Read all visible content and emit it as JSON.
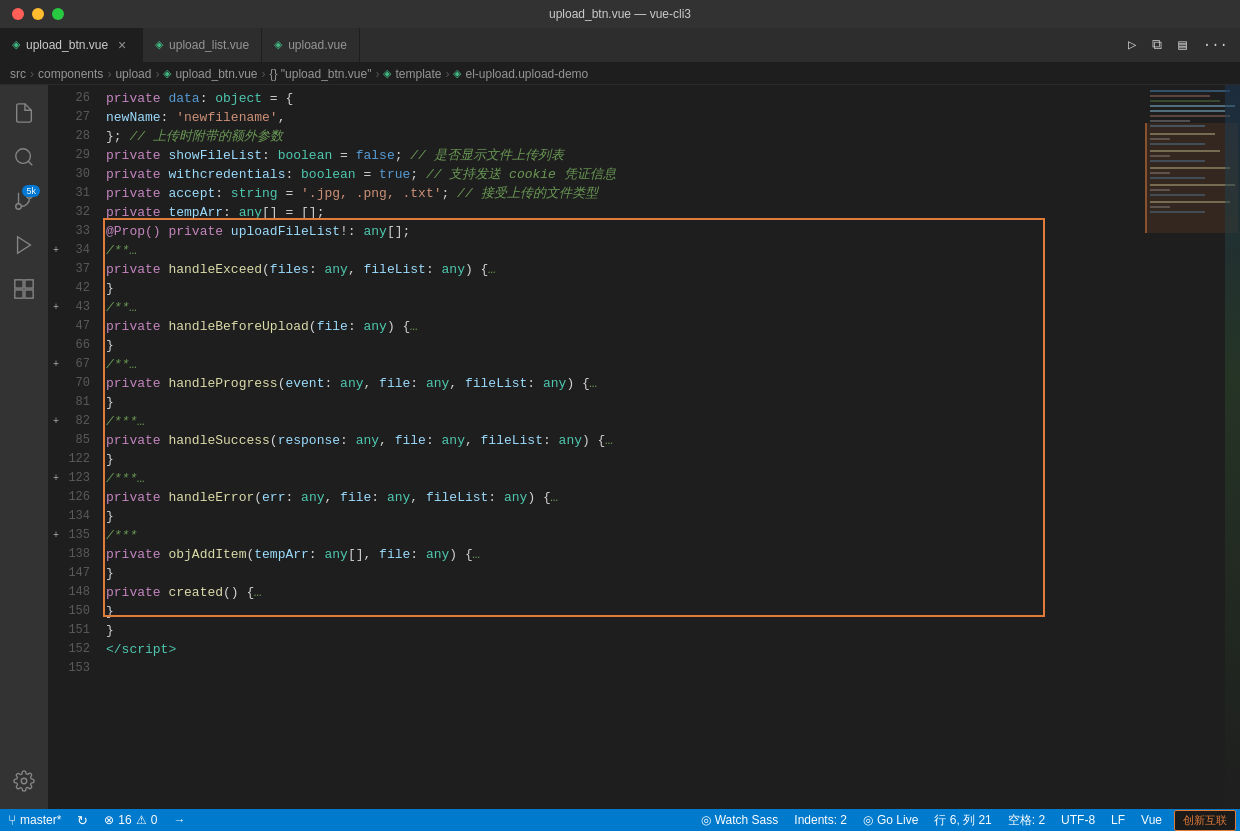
{
  "titleBar": {
    "title": "upload_btn.vue — vue-cli3"
  },
  "tabs": [
    {
      "id": "upload_btn",
      "label": "upload_btn.vue",
      "active": true,
      "icon": "V",
      "closable": true
    },
    {
      "id": "upload_list",
      "label": "upload_list.vue",
      "active": false,
      "icon": "V",
      "closable": false
    },
    {
      "id": "upload",
      "label": "upload.vue",
      "active": false,
      "icon": "V",
      "closable": false
    }
  ],
  "breadcrumb": [
    "src",
    "components",
    "upload",
    "upload_btn.vue",
    "{} \"upload_btn.vue\"",
    "template",
    "el-upload.upload-demo"
  ],
  "activityBar": {
    "icons": [
      {
        "id": "explorer",
        "symbol": "⎘",
        "active": false
      },
      {
        "id": "search",
        "symbol": "⌕",
        "active": false
      },
      {
        "id": "source-control",
        "symbol": "⑂",
        "active": false,
        "badge": "5k"
      },
      {
        "id": "debug",
        "symbol": "⬡",
        "active": false
      },
      {
        "id": "extensions",
        "symbol": "⊞",
        "active": false
      }
    ],
    "bottomIcons": [
      {
        "id": "settings",
        "symbol": "⚙",
        "active": false
      }
    ]
  },
  "codeLines": [
    {
      "num": "26",
      "hasExpand": false,
      "content": "    <span class='kw2'>private</span> <span class='kw'>data</span>: <span class='type'>object</span> = {"
    },
    {
      "num": "27",
      "hasExpand": false,
      "content": "      <span class='prop'>newName</span>: <span class='str'>'newfilename'</span>,"
    },
    {
      "num": "28",
      "hasExpand": false,
      "content": "    }; <span class='comment'>// 上传时附带的额外参数</span>"
    },
    {
      "num": "29",
      "hasExpand": false,
      "content": "    <span class='kw2'>private</span> <span class='prop'>showFileList</span>: <span class='type'>boolean</span> = <span class='bool'>false</span>; <span class='comment'>// 是否显示文件上传列表</span>"
    },
    {
      "num": "30",
      "hasExpand": false,
      "content": "    <span class='kw2'>private</span> <span class='prop'>withcredentials</span>: <span class='type'>boolean</span> = <span class='bool'>true</span>; <span class='comment'>// 支持发送 cookie 凭证信息</span>"
    },
    {
      "num": "31",
      "hasExpand": false,
      "content": "    <span class='kw2'>private</span> <span class='prop'>accept</span>: <span class='type'>string</span> = <span class='str'>'.jpg, .png, .txt'</span>; <span class='comment'>// 接受上传的文件类型</span>"
    },
    {
      "num": "32",
      "hasExpand": false,
      "content": "    <span class='kw2'>private</span> <span class='prop'>tempArr</span>: <span class='type'>any</span>[] = [];"
    },
    {
      "num": "33",
      "hasExpand": false,
      "content": "    <span class='decorator'>@Prop()</span> <span class='kw2'>private</span> <span class='prop'>uploadFileList</span>!: <span class='type'>any</span>[];"
    },
    {
      "num": "34",
      "hasExpand": true,
      "content": "    <span class='comment'>/**…</span>",
      "highlighted": true
    },
    {
      "num": "37",
      "hasExpand": false,
      "content": "    <span class='kw2'>private</span> <span class='fn'>handleExceed</span>(<span class='prop'>files</span>: <span class='type'>any</span>, <span class='prop'>fileList</span>: <span class='type'>any</span>) {<span class='comment'>…</span>",
      "highlighted": true
    },
    {
      "num": "42",
      "hasExpand": false,
      "content": "    }",
      "highlighted": true
    },
    {
      "num": "43",
      "hasExpand": true,
      "content": "    <span class='comment'>/**…</span>",
      "highlighted": true
    },
    {
      "num": "47",
      "hasExpand": false,
      "content": "    <span class='kw2'>private</span> <span class='fn'>handleBeforeUpload</span>(<span class='prop'>file</span>: <span class='type'>any</span>) {<span class='comment'>…</span>",
      "highlighted": true
    },
    {
      "num": "66",
      "hasExpand": false,
      "content": "    }",
      "highlighted": true
    },
    {
      "num": "67",
      "hasExpand": true,
      "content": "    <span class='comment'>/**…</span>",
      "highlighted": true
    },
    {
      "num": "70",
      "hasExpand": false,
      "content": "    <span class='kw2'>private</span> <span class='fn'>handleProgress</span>(<span class='prop'>event</span>: <span class='type'>any</span>, <span class='prop'>file</span>: <span class='type'>any</span>, <span class='prop'>fileList</span>: <span class='type'>any</span>) {<span class='comment'>…</span>",
      "highlighted": true
    },
    {
      "num": "81",
      "hasExpand": false,
      "content": "    }",
      "highlighted": true
    },
    {
      "num": "82",
      "hasExpand": true,
      "content": "    <span class='comment'>/***…</span>",
      "highlighted": true
    },
    {
      "num": "85",
      "hasExpand": false,
      "content": "    <span class='kw2'>private</span> <span class='fn'>handleSuccess</span>(<span class='prop'>response</span>: <span class='type'>any</span>, <span class='prop'>file</span>: <span class='type'>any</span>, <span class='prop'>fileList</span>: <span class='type'>any</span>) {<span class='comment'>…</span>",
      "highlighted": true
    },
    {
      "num": "122",
      "hasExpand": false,
      "content": "    }",
      "highlighted": true
    },
    {
      "num": "123",
      "hasExpand": true,
      "content": "    <span class='comment'>/***…</span>",
      "highlighted": true
    },
    {
      "num": "126",
      "hasExpand": false,
      "content": "    <span class='kw2'>private</span> <span class='fn'>handleError</span>(<span class='prop'>err</span>: <span class='type'>any</span>, <span class='prop'>file</span>: <span class='type'>any</span>, <span class='prop'>fileList</span>: <span class='type'>any</span>) {<span class='comment'>…</span>",
      "highlighted": true
    },
    {
      "num": "134",
      "hasExpand": false,
      "content": "    }",
      "highlighted": true
    },
    {
      "num": "135",
      "hasExpand": true,
      "content": "    <span class='comment'>/***</span>"
    },
    {
      "num": "138",
      "hasExpand": false,
      "content": "    <span class='kw2'>private</span> <span class='fn'>objAddItem</span>(<span class='prop'>tempArr</span>: <span class='type'>any</span>[], <span class='prop'>file</span>: <span class='type'>any</span>) {<span class='comment'>…</span>"
    },
    {
      "num": "147",
      "hasExpand": false,
      "content": "    }"
    },
    {
      "num": "148",
      "hasExpand": false,
      "content": "    <span class='kw2'>private</span> <span class='fn'>created</span>() {<span class='comment'>…</span>"
    },
    {
      "num": "150",
      "hasExpand": false,
      "content": "    }"
    },
    {
      "num": "151",
      "hasExpand": false,
      "content": "  }"
    },
    {
      "num": "152",
      "hasExpand": false,
      "content": "<span class='tag'>&lt;/script&gt;</span>"
    },
    {
      "num": "153",
      "hasExpand": false,
      "content": ""
    }
  ],
  "statusBar": {
    "left": [
      {
        "id": "git-branch",
        "icon": "⑂",
        "text": "master*"
      },
      {
        "id": "sync",
        "icon": "↻",
        "text": ""
      },
      {
        "id": "errors",
        "icon": "⊗",
        "text": "16",
        "extra": "⚠ 0"
      },
      {
        "id": "publish",
        "icon": "→",
        "text": ""
      }
    ],
    "right": [
      {
        "id": "watch-sass",
        "icon": "◎",
        "text": "Watch Sass"
      },
      {
        "id": "indents",
        "text": "Indents: 2"
      },
      {
        "id": "go-live",
        "icon": "◎",
        "text": "Go Live"
      },
      {
        "id": "line-col",
        "text": "行 6, 列 21"
      },
      {
        "id": "spaces",
        "text": "空格: 2"
      },
      {
        "id": "encoding",
        "text": "UTF-8"
      },
      {
        "id": "eol",
        "text": "LF"
      },
      {
        "id": "language",
        "text": "Vue"
      }
    ]
  },
  "watermark": {
    "text": "创新互联"
  }
}
